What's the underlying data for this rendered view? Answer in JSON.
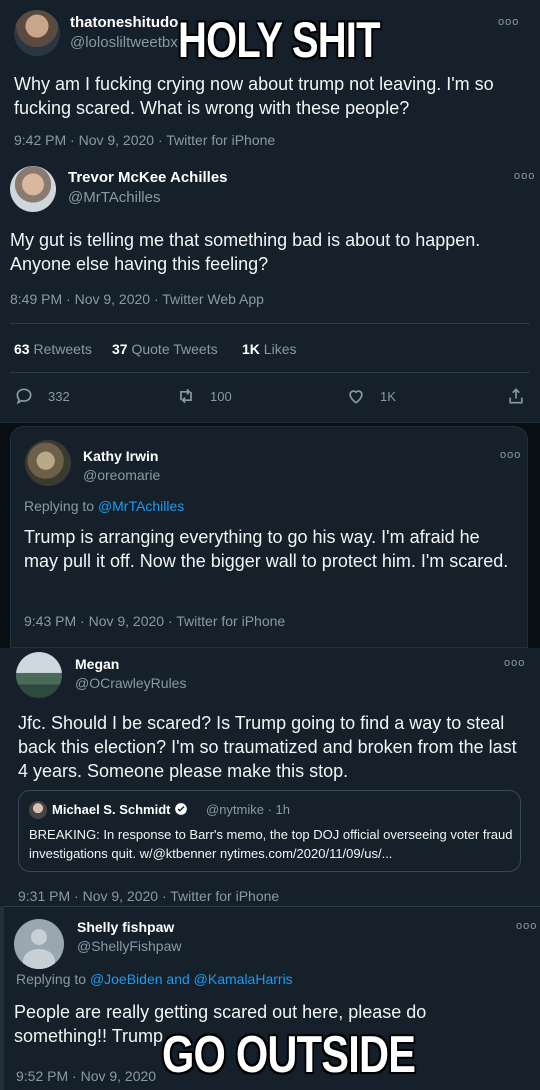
{
  "tweet1": {
    "name": "thatoneshitudo",
    "handle": "@lolosliltweetbx",
    "text": "Why am I fucking crying now about trump not leaving. I'm so fucking scared. What is wrong with these people?",
    "meta": "9:42 PM · Nov 9, 2020 · Twitter for iPhone"
  },
  "tweet2": {
    "name": "Trevor McKee Achilles",
    "handle": "@MrTAchilles",
    "text": "My gut is telling me that something bad is about to happen. Anyone else having this feeling?",
    "meta": "8:49 PM · Nov 9, 2020 · Twitter Web App",
    "stats": {
      "retweets_count": "63",
      "retweets_label": "Retweets",
      "quotes_count": "37",
      "quotes_label": "Quote Tweets",
      "likes_count": "1K",
      "likes_label": "Likes"
    },
    "actions": {
      "replies": "332",
      "retweets": "100",
      "likes": "1K"
    }
  },
  "tweet3": {
    "name": "Kathy Irwin",
    "handle": "@oreomarie",
    "replying_prefix": "Replying to",
    "replying_to": "@MrTAchilles",
    "text": "Trump is arranging everything to go his way. I'm afraid he may pull it off.   Now the bigger wall to protect him. I'm scared.",
    "meta": "9:43 PM · Nov 9, 2020 · Twitter for iPhone"
  },
  "tweet4": {
    "name": "Megan",
    "handle": "@OCrawleyRules",
    "text": "Jfc. Should I be scared? Is Trump going to find a way to steal back this election? I'm so traumatized and broken from the last 4 years. Someone please make this stop.",
    "quote": {
      "name": "Michael S. Schmidt",
      "handle": "@nytmike · 1h",
      "text": "BREAKING: In response to Barr's memo, the top DOJ official overseeing voter fraud investigations quit. w/@ktbenner  nytimes.com/2020/11/09/us/..."
    },
    "meta": "9:31 PM · Nov 9, 2020 · Twitter for iPhone"
  },
  "tweet5": {
    "name": "Shelly fishpaw",
    "handle": "@ShellyFishpaw",
    "replying_prefix": "Replying to",
    "replying_to": "@JoeBiden and @KamalaHarris",
    "text": "People are really getting scared out here, please do something!! Trump",
    "meta": "9:52 PM · Nov 9, 2020"
  },
  "more_label": "ooo",
  "meme": {
    "top": "HOLY SHIT",
    "bottom": "GO OUTSIDE"
  },
  "colors": {
    "background": "#15202b",
    "link": "#1d9bf0",
    "muted": "#8b98a5"
  }
}
